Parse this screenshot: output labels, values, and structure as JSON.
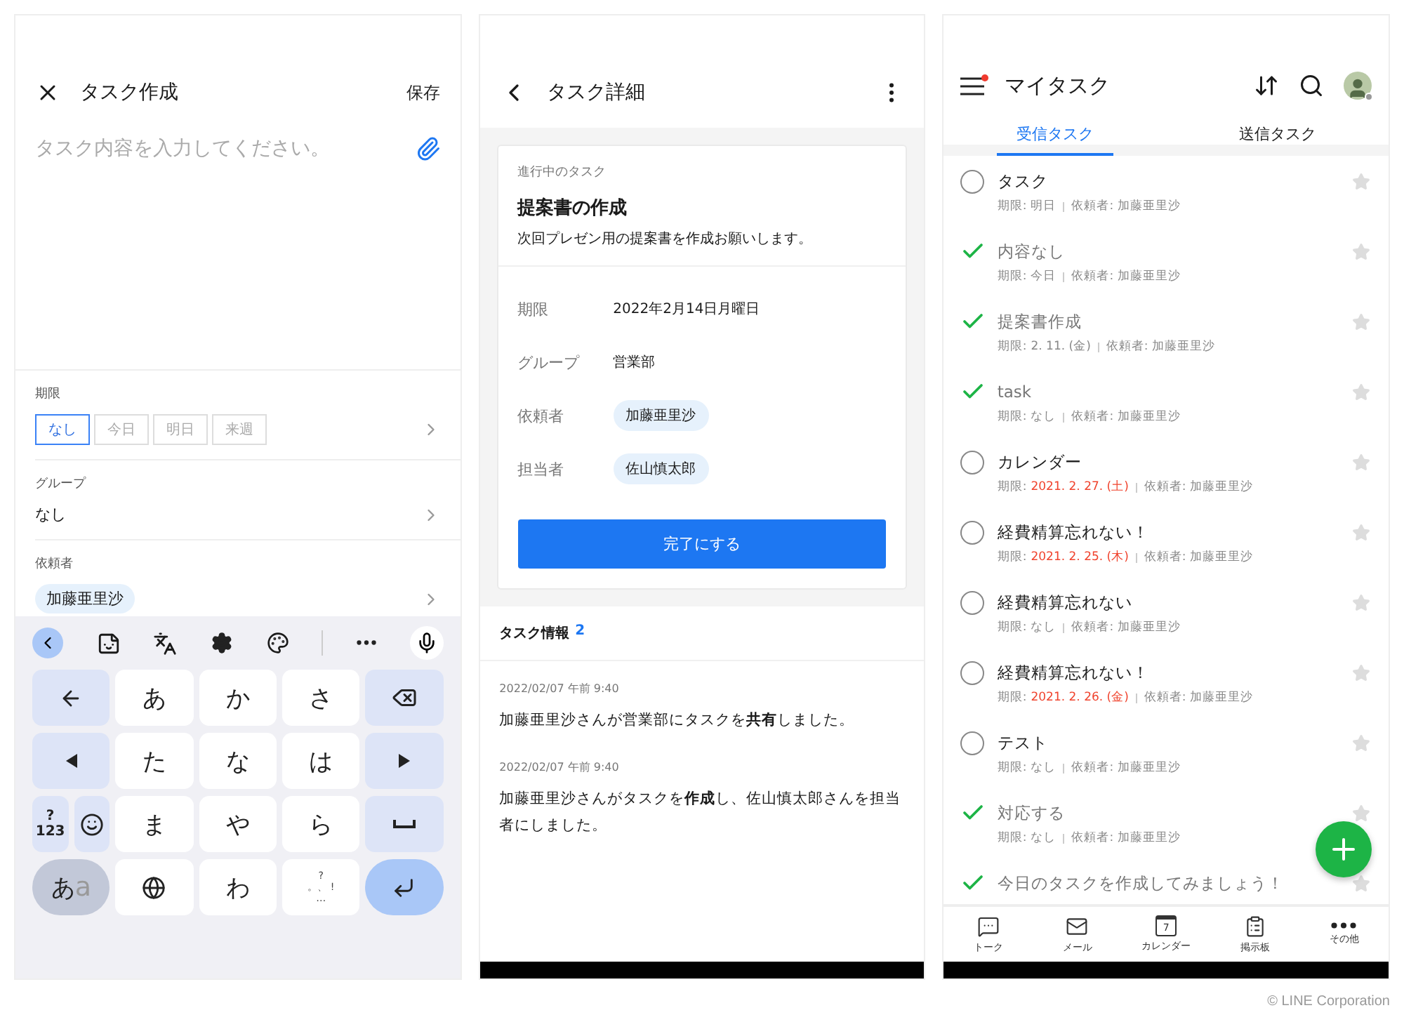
{
  "create": {
    "title": "タスク作成",
    "save": "保存",
    "placeholder": "タスク内容を入力してください。",
    "deadline": {
      "label": "期限",
      "options": [
        {
          "label": "なし",
          "selected": true
        },
        {
          "label": "今日",
          "selected": false
        },
        {
          "label": "明日",
          "selected": false
        },
        {
          "label": "来週",
          "selected": false
        }
      ]
    },
    "group": {
      "label": "グループ",
      "value": "なし"
    },
    "requester": {
      "label": "依頼者",
      "chip": "加藤亜里沙"
    },
    "keyboard": {
      "rows": [
        [
          {
            "kind": "undo"
          },
          {
            "kind": "char",
            "label": "あ"
          },
          {
            "kind": "char",
            "label": "か"
          },
          {
            "kind": "char",
            "label": "さ"
          },
          {
            "kind": "backspace"
          }
        ],
        [
          {
            "kind": "left"
          },
          {
            "kind": "char",
            "label": "た"
          },
          {
            "kind": "char",
            "label": "な"
          },
          {
            "kind": "char",
            "label": "は"
          },
          {
            "kind": "right"
          }
        ],
        [
          {
            "kind": "split",
            "keys": [
              {
                "kind": "symbols",
                "label": "?123"
              },
              {
                "kind": "emoji"
              }
            ]
          },
          {
            "kind": "char",
            "label": "ま"
          },
          {
            "kind": "char",
            "label": "や"
          },
          {
            "kind": "char",
            "label": "ら"
          },
          {
            "kind": "space"
          }
        ],
        [
          {
            "kind": "mode",
            "label": "あ",
            "sub": "a"
          },
          {
            "kind": "globe"
          },
          {
            "kind": "char",
            "label": "わ"
          },
          {
            "kind": "punct",
            "marks": [
              "?",
              "。、 !",
              "…"
            ]
          },
          {
            "kind": "enter"
          }
        ]
      ]
    }
  },
  "detail": {
    "title": "タスク詳細",
    "status": "進行中のタスク",
    "task_title": "提案書の作成",
    "description": "次回プレゼン用の提案書を作成お願いします。",
    "fields": [
      {
        "label": "期限",
        "kind": "text",
        "value": "2022年2月14日月曜日"
      },
      {
        "label": "グループ",
        "kind": "text",
        "value": "営業部"
      },
      {
        "label": "依頼者",
        "kind": "chip",
        "value": "加藤亜里沙"
      },
      {
        "label": "担当者",
        "kind": "chip",
        "value": "佐山慎太郎"
      }
    ],
    "complete_button": "完了にする",
    "info": {
      "label": "タスク情報",
      "count": "2",
      "entries": [
        {
          "time": "2022/02/07 午前 9:40",
          "text": "加藤亜里沙さんが営業部にタスクを**共有**しました。"
        },
        {
          "time": "2022/02/07 午前 9:40",
          "text": "加藤亜里沙さんがタスクを**作成**し、佐山慎太郎さんを担当者にしました。"
        }
      ]
    }
  },
  "mytasks": {
    "title": "マイタスク",
    "menu_notification": true,
    "tabs": [
      {
        "label": "受信タスク",
        "selected": true
      },
      {
        "label": "送信タスク",
        "selected": false
      }
    ],
    "tasks": [
      {
        "title": "タスク",
        "done": false,
        "starred": false,
        "due_label": "期限:",
        "due": "明日",
        "overdue": false,
        "requester": "依頼者: 加藤亜里沙"
      },
      {
        "title": "内容なし",
        "done": true,
        "starred": false,
        "due_label": "期限:",
        "due": "今日",
        "overdue": false,
        "requester": "依頼者: 加藤亜里沙"
      },
      {
        "title": "提案書作成",
        "done": true,
        "starred": false,
        "due_label": "期限:",
        "due": "2. 11. (金)",
        "overdue": false,
        "requester": "依頼者: 加藤亜里沙"
      },
      {
        "title": "task",
        "done": true,
        "starred": false,
        "due_label": "期限:",
        "due": "なし",
        "overdue": false,
        "requester": "依頼者: 加藤亜里沙"
      },
      {
        "title": "カレンダー",
        "done": false,
        "starred": false,
        "due_label": "期限:",
        "due": "2021. 2. 27. (土)",
        "overdue": true,
        "requester": "依頼者: 加藤亜里沙"
      },
      {
        "title": "経費精算忘れない！",
        "done": false,
        "starred": false,
        "due_label": "期限:",
        "due": "2021. 2. 25. (木)",
        "overdue": true,
        "requester": "依頼者: 加藤亜里沙"
      },
      {
        "title": "経費精算忘れない",
        "done": false,
        "starred": false,
        "due_label": "期限:",
        "due": "なし",
        "overdue": false,
        "requester": "依頼者: 加藤亜里沙"
      },
      {
        "title": "経費精算忘れない！",
        "done": false,
        "starred": false,
        "due_label": "期限:",
        "due": "2021. 2. 26. (金)",
        "overdue": true,
        "requester": "依頼者: 加藤亜里沙"
      },
      {
        "title": "テスト",
        "done": false,
        "starred": false,
        "due_label": "期限:",
        "due": "なし",
        "overdue": false,
        "requester": "依頼者: 加藤亜里沙"
      },
      {
        "title": "対応する",
        "done": true,
        "starred": false,
        "due_label": "期限:",
        "due": "なし",
        "overdue": false,
        "requester": "依頼者: 加藤亜里沙"
      },
      {
        "title": "今日のタスクを作成してみましょう！",
        "done": true,
        "starred": false
      }
    ],
    "nav": [
      {
        "kind": "talk",
        "label": "トーク"
      },
      {
        "kind": "mail",
        "label": "メール"
      },
      {
        "kind": "calendar",
        "label": "カレンダー",
        "day": "7"
      },
      {
        "kind": "board",
        "label": "掲示板"
      },
      {
        "kind": "more",
        "label": "その他"
      }
    ]
  },
  "footer": "© LINE Corporation"
}
